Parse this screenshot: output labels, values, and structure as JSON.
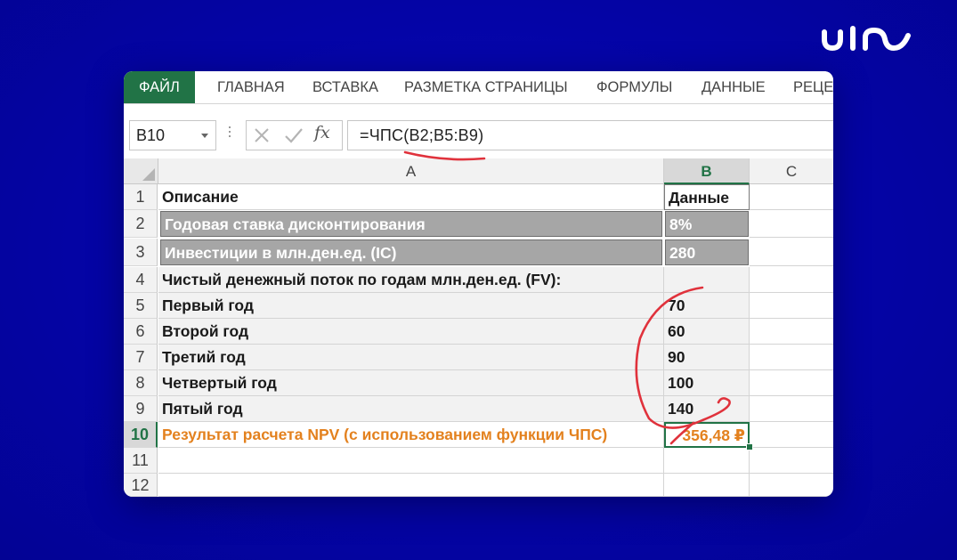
{
  "ribbon": {
    "tabs": [
      "ФАЙЛ",
      "ГЛАВНАЯ",
      "ВСТАВКА",
      "РАЗМЕТКА СТРАНИЦЫ",
      "ФОРМУЛЫ",
      "ДАННЫЕ",
      "РЕЦЕ"
    ]
  },
  "formula_bar": {
    "name_box": "B10",
    "fx_label": "fx",
    "formula": "=ЧПС(B2;B5:B9)"
  },
  "columns": [
    "A",
    "B",
    "C"
  ],
  "selected_column": "B",
  "rows": [
    {
      "num": "1",
      "a": "Описание",
      "b": "Данные",
      "style": "header"
    },
    {
      "num": "2",
      "a": "Годовая ставка дисконтирования",
      "b": "8%",
      "style": "dark"
    },
    {
      "num": "3",
      "a": "Инвестиции в млн.ден.ед. (IC)",
      "b": "280",
      "style": "dark"
    },
    {
      "num": "4",
      "a": "Чистый денежный поток по годам млн.ден.ед. (FV):",
      "b": "",
      "style": "light"
    },
    {
      "num": "5",
      "a": "Первый год",
      "b": "70",
      "style": "light"
    },
    {
      "num": "6",
      "a": "Второй год",
      "b": "60",
      "style": "light"
    },
    {
      "num": "7",
      "a": "Третий год",
      "b": "90",
      "style": "light"
    },
    {
      "num": "8",
      "a": "Четвертый год",
      "b": "100",
      "style": "light"
    },
    {
      "num": "9",
      "a": "Пятый год",
      "b": "140",
      "style": "light"
    },
    {
      "num": "10",
      "a": "Результат расчета NPV (с использованием функции ЧПС)",
      "b": "356,48 ₽",
      "style": "result"
    },
    {
      "num": "11",
      "a": "",
      "b": "",
      "style": "empty"
    },
    {
      "num": "12",
      "a": "",
      "b": "",
      "style": "empty"
    }
  ],
  "colors": {
    "excel_green": "#217346",
    "background_blue": "#0404a6",
    "result_orange": "#e3811e",
    "annotation_red": "#e0323c",
    "dark_fill": "#a6a6a6",
    "light_fill": "#f2f2f2"
  },
  "logo": "uim-logo"
}
